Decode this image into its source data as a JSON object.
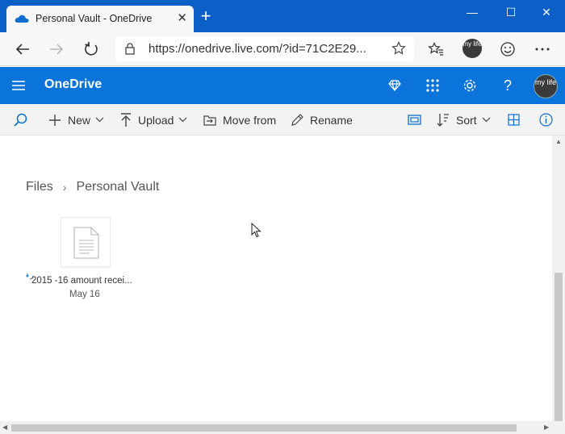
{
  "browser": {
    "tab_title": "Personal Vault - OneDrive",
    "url": "https://onedrive.live.com/?id=71C2E29...",
    "avatar_text": "my life"
  },
  "app": {
    "brand": "OneDrive",
    "avatar_text": "my life",
    "accent_color": "#0b74da"
  },
  "commands": {
    "new": "New",
    "upload": "Upload",
    "move_from": "Move from",
    "rename": "Rename",
    "sort": "Sort"
  },
  "breadcrumb": {
    "root": "Files",
    "current": "Personal Vault"
  },
  "files": [
    {
      "name": "2015 -16 amount recei...",
      "date": "May 16",
      "icon": "document-icon"
    }
  ]
}
